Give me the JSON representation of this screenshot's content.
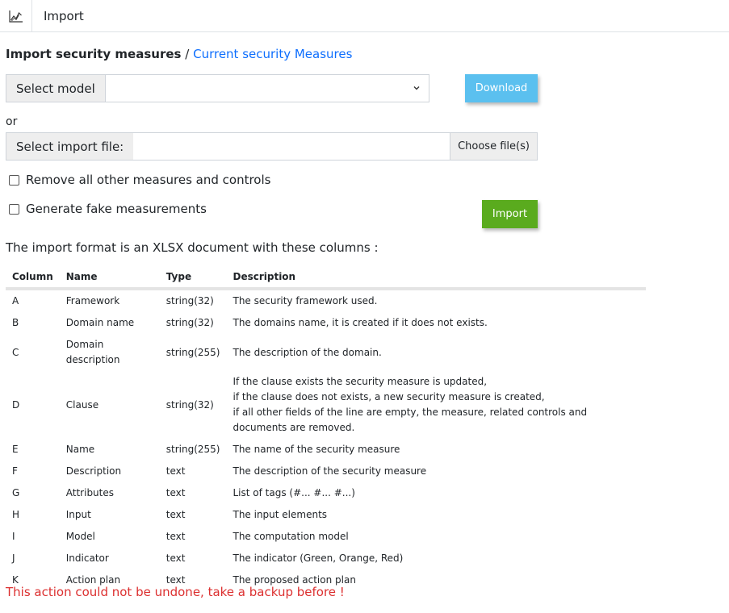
{
  "topbar": {
    "title": "Import",
    "logo_icon": "line-chart-icon"
  },
  "breadcrumb": {
    "current": "Import security measures",
    "separator": "/",
    "link": "Current security Measures"
  },
  "model_select": {
    "label": "Select model",
    "value": ""
  },
  "download_label": "Download",
  "or_text": "or",
  "file_select": {
    "label": "Select import file:",
    "choose_label": "Choose file(s)"
  },
  "options": {
    "remove_label": "Remove all other measures and controls",
    "fake_label": "Generate fake measurements"
  },
  "import_label": "Import",
  "format_text": "The import format is an XLSX document with these columns :",
  "table": {
    "headers": [
      "Column",
      "Name",
      "Type",
      "Description"
    ],
    "rows": [
      {
        "col": "A",
        "name": "Framework",
        "type": "string(32)",
        "desc": [
          "The security framework used."
        ]
      },
      {
        "col": "B",
        "name": "Domain name",
        "type": "string(32)",
        "desc": [
          "The domains name, it is created if it does not exists."
        ]
      },
      {
        "col": "C",
        "name": "Domain description",
        "type": "string(255)",
        "desc": [
          "The description of the domain."
        ]
      },
      {
        "col": "D",
        "name": "Clause",
        "type": "string(32)",
        "desc": [
          "If the clause exists the security measure is updated,",
          "if the clause does not exists, a new security measure is created,",
          "if all other fields of the line are empty, the measure, related controls and documents are removed."
        ]
      },
      {
        "col": "E",
        "name": "Name",
        "type": "string(255)",
        "desc": [
          "The name of the security measure"
        ]
      },
      {
        "col": "F",
        "name": "Description",
        "type": "text",
        "desc": [
          "The description of the security measure"
        ]
      },
      {
        "col": "G",
        "name": "Attributes",
        "type": "text",
        "desc": [
          "List of tags (#... #... #...)"
        ]
      },
      {
        "col": "H",
        "name": "Input",
        "type": "text",
        "desc": [
          "The input elements"
        ]
      },
      {
        "col": "I",
        "name": "Model",
        "type": "text",
        "desc": [
          "The computation model"
        ]
      },
      {
        "col": "J",
        "name": "Indicator",
        "type": "text",
        "desc": [
          "The indicator (Green, Orange, Red)"
        ]
      },
      {
        "col": "K",
        "name": "Action plan",
        "type": "text",
        "desc": [
          "The proposed action plan"
        ]
      }
    ]
  },
  "warning": "This action could not be undone, take a backup before !",
  "colors": {
    "download": "#5bc0ef",
    "import": "#5aab1e",
    "link": "#0d6efd",
    "warning": "#dc3030"
  }
}
